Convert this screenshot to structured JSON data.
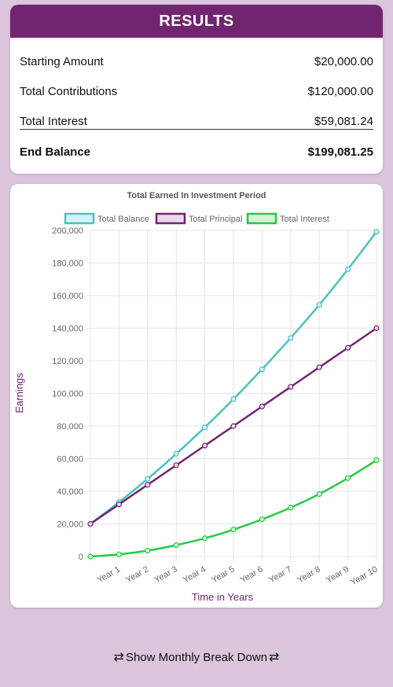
{
  "results": {
    "title": "RESULTS",
    "rows": [
      {
        "label": "Starting Amount",
        "value": "$20,000.00"
      },
      {
        "label": "Total Contributions",
        "value": "$120,000.00"
      },
      {
        "label": "Total Interest",
        "value": "$59,081.24"
      },
      {
        "label": "End Balance",
        "value": "$199,081.25"
      }
    ]
  },
  "chart_data": {
    "type": "line",
    "title": "Total Earned In Investment Period",
    "xlabel": "Time in Years",
    "ylabel": "Earnings",
    "ylim": [
      0,
      200000
    ],
    "yticks": [
      "0",
      "20,000",
      "40,000",
      "60,000",
      "80,000",
      "100,000",
      "120,000",
      "140,000",
      "160,000",
      "180,000",
      "200,000"
    ],
    "categories": [
      "",
      "Year 1",
      "Year 2",
      "Year 3",
      "Year 4",
      "Year 5",
      "Year 6",
      "Year 7",
      "Year 8",
      "Year 9",
      "Year 10"
    ],
    "grid": true,
    "legend": "top",
    "series": [
      {
        "name": "Total Balance",
        "color": "#4bc0c0",
        "fill": "#d6f2f2",
        "values": [
          20000,
          33300,
          47600,
          63000,
          79200,
          96500,
          114800,
          134000,
          154300,
          176100,
          199081
        ]
      },
      {
        "name": "Total Principal",
        "color": "#712470",
        "fill": "#ead9ea",
        "values": [
          20000,
          32000,
          44000,
          56000,
          68000,
          80000,
          92000,
          104000,
          116000,
          128000,
          140000
        ]
      },
      {
        "name": "Total Interest",
        "color": "#22cc44",
        "fill": "#d6f2d8",
        "values": [
          0,
          1300,
          3600,
          7000,
          11200,
          16500,
          22800,
          30000,
          38300,
          48100,
          59081
        ]
      }
    ]
  },
  "footer": {
    "button_label": "Show Monthly Break Down",
    "icon": "repeat-icon",
    "icon_glyph": "⇄"
  }
}
